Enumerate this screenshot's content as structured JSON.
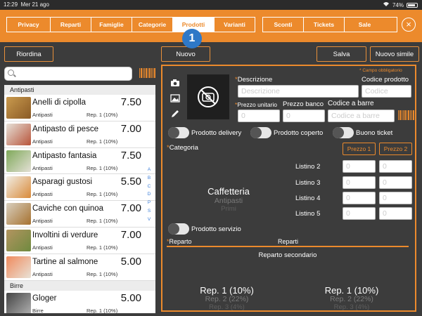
{
  "status_bar": {
    "time": "12:29",
    "date": "Mer 21 ago",
    "battery": "74%",
    "battery_level": 0.74,
    "icons": [
      "wifi-icon",
      "battery-icon"
    ]
  },
  "nav": {
    "tabs": [
      "Privacy",
      "Reparti",
      "Famiglie",
      "Categorie",
      "Prodotti",
      "Varianti",
      "Sconti",
      "Tickets",
      "Sale"
    ],
    "active_tab": "Prodotti",
    "step_badge": "1",
    "close_icon": "close-icon"
  },
  "actions": {
    "riordina": "Riordina",
    "nuovo": "Nuovo",
    "salva": "Salva",
    "nuovo_simile": "Nuovo simile"
  },
  "search": {
    "placeholder": "",
    "icon": "search-icon"
  },
  "product_list": {
    "sections": [
      {
        "name": "Antipasti",
        "items": [
          {
            "name": "Anelli di cipolla",
            "price": "7.50",
            "category": "Antipasti",
            "reparto": "Rep. 1 (10%)"
          },
          {
            "name": "Antipasto di pesce",
            "price": "7.00",
            "category": "Antipasti",
            "reparto": "Rep. 1 (10%)"
          },
          {
            "name": "Antipasto fantasia",
            "price": "7.50",
            "category": "Antipasti",
            "reparto": "Rep. 1 (10%)"
          },
          {
            "name": "Asparagi gustosi",
            "price": "5.50",
            "category": "Antipasti",
            "reparto": "Rep. 1 (10%)"
          },
          {
            "name": "Caviche con quinoa",
            "price": "7.00",
            "category": "Antipasti",
            "reparto": "Rep. 1 (10%)"
          },
          {
            "name": "Involtini di verdure",
            "price": "7.00",
            "category": "Antipasti",
            "reparto": "Rep. 1 (10%)"
          },
          {
            "name": "Tartine al salmone",
            "price": "5.00",
            "category": "Antipasti",
            "reparto": "Rep. 1 (10%)"
          }
        ]
      },
      {
        "name": "Birre",
        "items": [
          {
            "name": "Gloger",
            "price": "5.00",
            "category": "Birre",
            "reparto": "Rep. 1 (10%)"
          }
        ]
      }
    ],
    "alpha_index": [
      "A",
      "B",
      "C",
      "D",
      "P",
      "S",
      "V"
    ]
  },
  "form": {
    "required_note": "* Campo obbligatorio",
    "descrizione_label": "Descrizione",
    "descrizione_placeholder": "Descrizione",
    "codice_prodotto_label": "Codice prodotto",
    "codice_placeholder": "Codice",
    "prezzo_unitario_label": "Prezzo unitario",
    "prezzo_unitario_value": "0",
    "prezzo_banco_label": "Prezzo banco",
    "prezzo_banco_value": "0",
    "codice_barre_label": "Codice a barre",
    "codice_barre_placeholder": "Codice a barre",
    "toggles": {
      "delivery": "Prodotto delivery",
      "coperto": "Prodotto coperto",
      "buono": "Buono ticket",
      "servizio": "Prodotto servizio"
    },
    "categoria_label": "Categoria",
    "categoria_picker": {
      "selected": "Caffetteria",
      "next": [
        "Antipasti",
        "Primi"
      ]
    },
    "prezzo1": "Prezzo 1",
    "prezzo2": "Prezzo 2",
    "listini": [
      "Listino 2",
      "Listino 3",
      "Listino 4",
      "Listino 5"
    ],
    "listino_placeholder": "0",
    "reparto_label": "Reparto",
    "reparti_label": "Reparti",
    "reparto_secondario": "Reparto secondario",
    "reparto_picker": {
      "selected": "Rep. 1 (10%)",
      "next": [
        "Rep. 2 (22%)",
        "Rep. 3 (4%)"
      ]
    },
    "reparto2_picker": {
      "selected": "Rep. 1 (10%)",
      "next": [
        "Rep. 2 (22%)",
        "Rep. 3 (4%)"
      ]
    }
  },
  "colors": {
    "accent": "#ec8a2c",
    "background": "#3c3c3c",
    "badge": "#2e78c7"
  }
}
